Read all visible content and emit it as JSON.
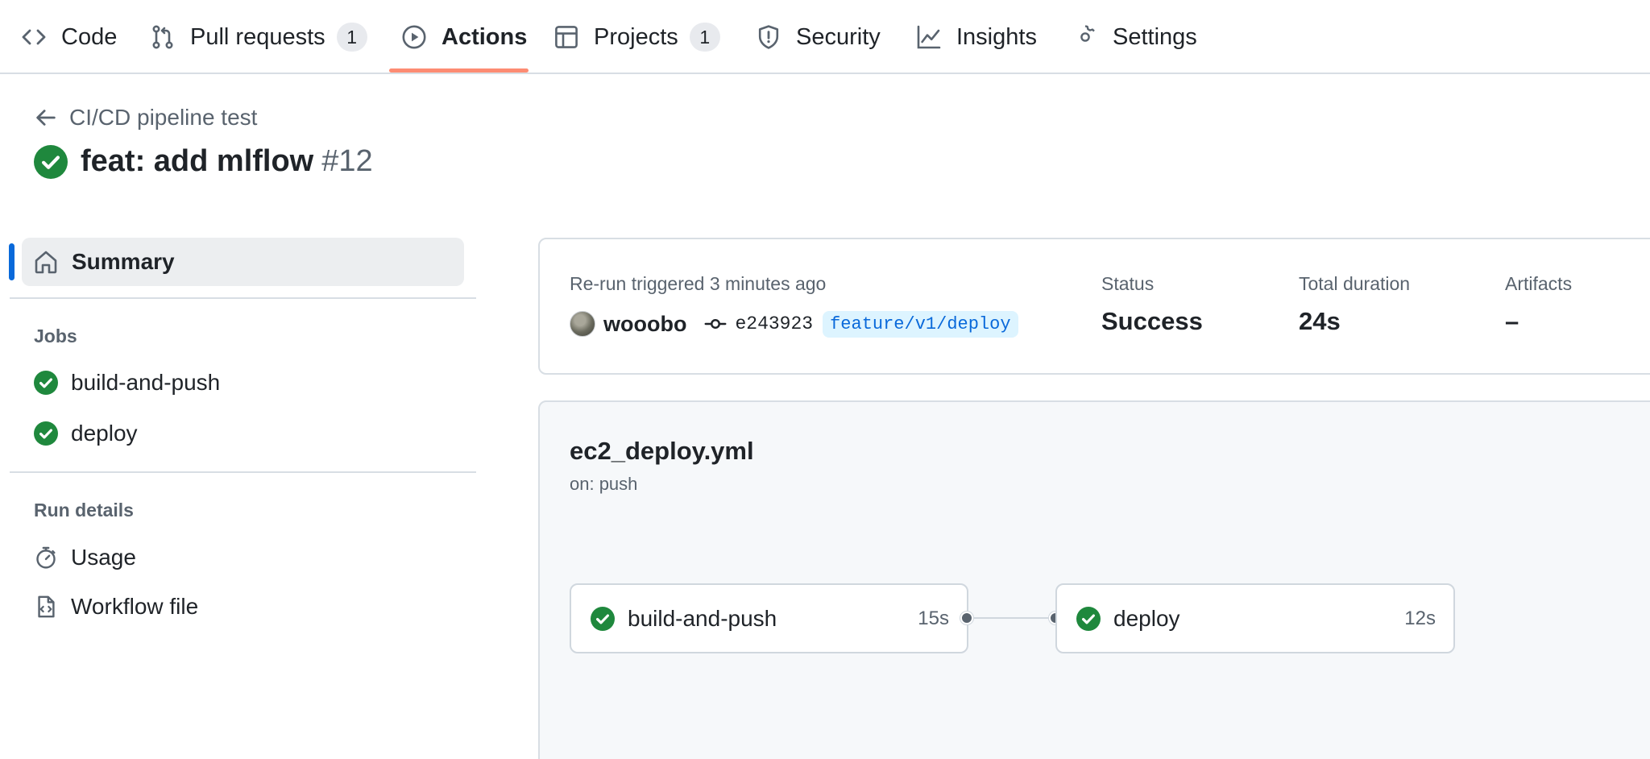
{
  "nav": {
    "tabs": [
      {
        "label": "Code",
        "icon": "code-icon"
      },
      {
        "label": "Pull requests",
        "icon": "pull-request-icon",
        "count": "1"
      },
      {
        "label": "Actions",
        "icon": "play-icon",
        "active": true
      },
      {
        "label": "Projects",
        "icon": "table-icon",
        "count": "1"
      },
      {
        "label": "Security",
        "icon": "shield-icon"
      },
      {
        "label": "Insights",
        "icon": "graph-icon"
      },
      {
        "label": "Settings",
        "icon": "gear-icon"
      }
    ]
  },
  "header": {
    "back_label": "CI/CD pipeline test",
    "run_title": "feat: add mlflow",
    "run_number": "#12"
  },
  "sidebar": {
    "summary_label": "Summary",
    "jobs_heading": "Jobs",
    "jobs": [
      {
        "label": "build-and-push"
      },
      {
        "label": "deploy"
      }
    ],
    "run_details_heading": "Run details",
    "details": [
      {
        "label": "Usage",
        "icon": "stopwatch-icon"
      },
      {
        "label": "Workflow file",
        "icon": "file-code-icon"
      }
    ]
  },
  "summary": {
    "trigger_text": "Re-run triggered 3 minutes ago",
    "actor": "wooobo",
    "commit_sha": "e243923",
    "branch": "feature/v1/deploy",
    "status_label": "Status",
    "status_value": "Success",
    "duration_label": "Total duration",
    "duration_value": "24s",
    "artifacts_label": "Artifacts",
    "artifacts_value": "–"
  },
  "workflow": {
    "file": "ec2_deploy.yml",
    "trigger": "on: push",
    "jobs": [
      {
        "name": "build-and-push",
        "duration": "15s",
        "status": "success"
      },
      {
        "name": "deploy",
        "duration": "12s",
        "status": "success"
      }
    ]
  },
  "colors": {
    "success": "#1f883d",
    "accent": "#0969da",
    "active_tab_underline": "#fd8c73"
  }
}
